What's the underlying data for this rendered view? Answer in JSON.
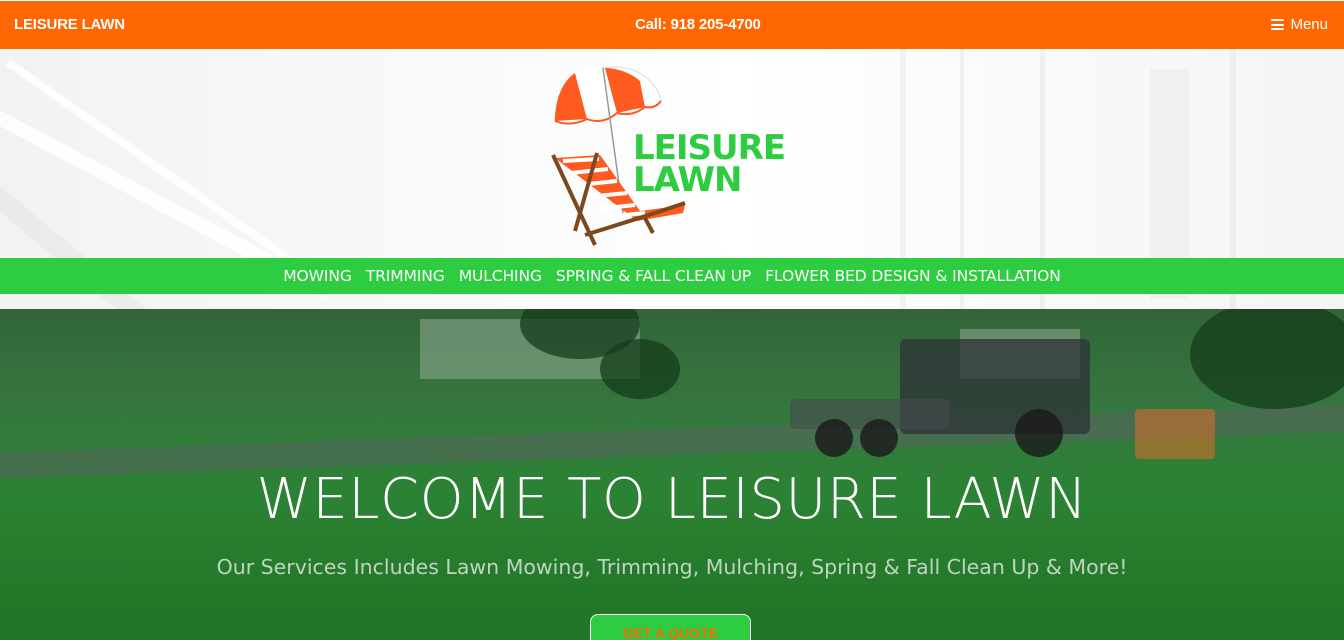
{
  "topbar": {
    "brand": "LEISURE LAWN",
    "phone": "Call: 918 205-4700",
    "menu_label": "Menu",
    "menu_icon": "hamburger-icon"
  },
  "logo": {
    "line1": "LEISURE",
    "line2": "LAWN",
    "icon": "umbrella-beach-chair-icon",
    "colors": {
      "green": "#2ecc40",
      "orange": "#ff5a1f",
      "brown": "#7a4a1e"
    }
  },
  "services_nav": [
    "MOWING",
    "TRIMMING",
    "MULCHING",
    "SPRING & FALL CLEAN UP",
    "FLOWER BED DESIGN & INSTALLATION"
  ],
  "hero": {
    "title": "WELCOME TO LEISURE LAWN",
    "subtitle": "Our Services Includes Lawn Mowing, Trimming, Mulching, Spring & Fall Clean Up & More!",
    "cta_label": "GET A QUOTE"
  },
  "colors": {
    "accent_orange": "#ff6604",
    "accent_green": "#2ecc40"
  }
}
